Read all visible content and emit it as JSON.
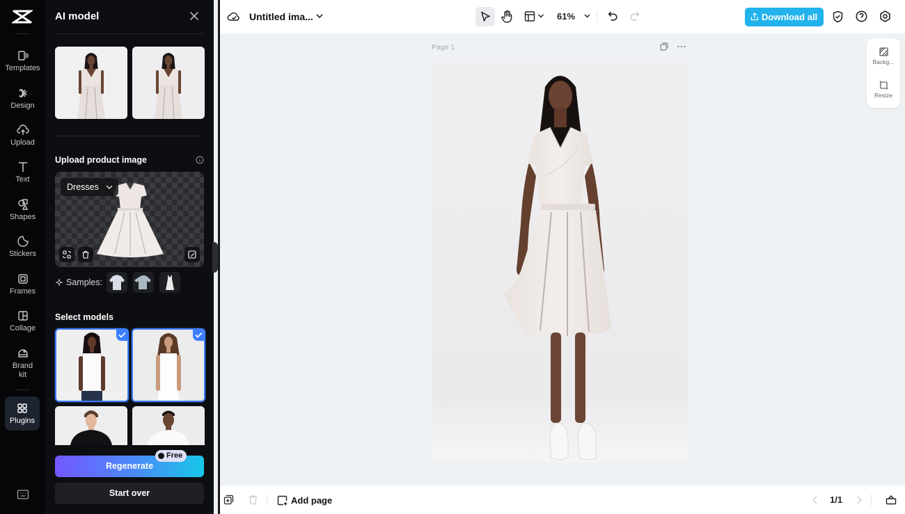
{
  "rail": {
    "items": [
      {
        "label": "Templates",
        "icon": "templates-icon"
      },
      {
        "label": "Design",
        "icon": "design-icon"
      },
      {
        "label": "Upload",
        "icon": "upload-icon"
      },
      {
        "label": "Text",
        "icon": "text-icon"
      },
      {
        "label": "Shapes",
        "icon": "shapes-icon"
      },
      {
        "label": "Stickers",
        "icon": "stickers-icon"
      },
      {
        "label": "Frames",
        "icon": "frames-icon"
      },
      {
        "label": "Collage",
        "icon": "collage-icon"
      },
      {
        "label": "Brand kit",
        "icon": "brand-kit-icon"
      },
      {
        "label": "Plugins",
        "icon": "plugins-icon",
        "active": true
      }
    ]
  },
  "panel": {
    "title": "AI model",
    "results": [
      {
        "alt": "Generated model result 1 in white wrap dress"
      },
      {
        "alt": "Generated model result 2 in white wrap dress"
      }
    ],
    "upload_label": "Upload product image",
    "category": "Dresses",
    "samples_label": "Samples:",
    "samples": [
      {
        "alt": "shirt sample"
      },
      {
        "alt": "t-shirt sample"
      },
      {
        "alt": "dress sample"
      }
    ],
    "select_models_label": "Select models",
    "models": [
      {
        "alt": "female model 1",
        "selected": true
      },
      {
        "alt": "female model 2",
        "selected": true
      },
      {
        "alt": "male model 1",
        "selected": false
      },
      {
        "alt": "male model 2",
        "selected": false
      }
    ],
    "regenerate_label": "Regenerate",
    "free_badge": "Free",
    "start_over_label": "Start over"
  },
  "topbar": {
    "doc_title": "Untitled ima...",
    "zoom": "61%",
    "download_label": "Download all",
    "accent": "#22b3ec"
  },
  "canvas": {
    "page_label": "Page 1",
    "float_tools": [
      {
        "label": "Backg...",
        "icon": "background-icon"
      },
      {
        "label": "Resize",
        "icon": "resize-icon"
      }
    ]
  },
  "bottombar": {
    "add_page_label": "Add page",
    "pager": "1/1"
  }
}
